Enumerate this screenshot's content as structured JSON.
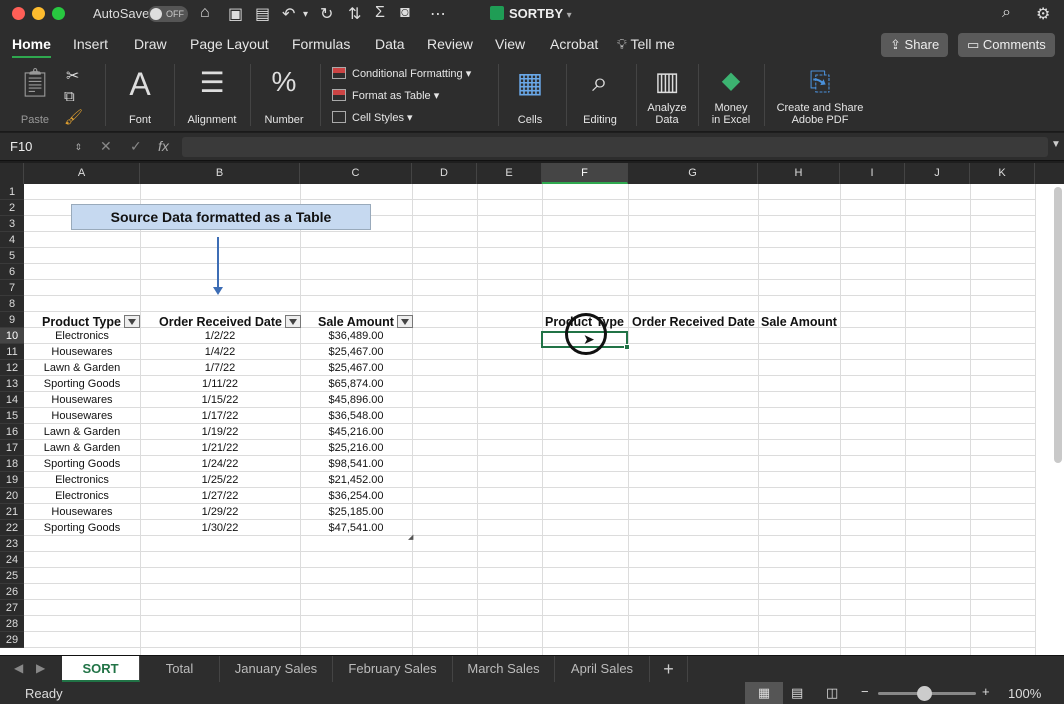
{
  "window": {
    "autosave_label": "AutoSave",
    "autosave_state": "OFF",
    "doc_title": "SORTBY"
  },
  "ribbon_tabs": [
    "Home",
    "Insert",
    "Draw",
    "Page Layout",
    "Formulas",
    "Data",
    "Review",
    "View",
    "Acrobat",
    "Tell me"
  ],
  "header_buttons": {
    "share": "Share",
    "comments": "Comments"
  },
  "ribbon": {
    "paste": "Paste",
    "font": "Font",
    "alignment": "Alignment",
    "number": "Number",
    "conditional_formatting": "Conditional Formatting",
    "format_as_table": "Format as Table",
    "cell_styles": "Cell Styles",
    "cells": "Cells",
    "editing": "Editing",
    "analyze_data_1": "Analyze",
    "analyze_data_2": "Data",
    "money_1": "Money",
    "money_2": "in Excel",
    "adobe_1": "Create and Share",
    "adobe_2": "Adobe PDF"
  },
  "formula_bar": {
    "name_box": "F10",
    "fx": "fx",
    "value": ""
  },
  "columns": [
    "A",
    "B",
    "C",
    "D",
    "E",
    "F",
    "G",
    "H",
    "I",
    "J",
    "K"
  ],
  "rows": [
    "1",
    "2",
    "3",
    "4",
    "5",
    "6",
    "7",
    "8",
    "9",
    "10",
    "11",
    "12",
    "13",
    "14",
    "15",
    "16",
    "17",
    "18",
    "19",
    "20",
    "21",
    "22",
    "23",
    "24",
    "25",
    "26",
    "27",
    "28",
    "29"
  ],
  "banner": "Source Data formatted as a Table",
  "table": {
    "headers": [
      "Product Type",
      "Order Received Date",
      "Sale Amount"
    ],
    "rows": [
      [
        "Electronics",
        "1/2/22",
        "$36,489.00"
      ],
      [
        "Housewares",
        "1/4/22",
        "$25,467.00"
      ],
      [
        "Lawn & Garden",
        "1/7/22",
        "$25,467.00"
      ],
      [
        "Sporting Goods",
        "1/11/22",
        "$65,874.00"
      ],
      [
        "Housewares",
        "1/15/22",
        "$45,896.00"
      ],
      [
        "Housewares",
        "1/17/22",
        "$36,548.00"
      ],
      [
        "Lawn & Garden",
        "1/19/22",
        "$45,216.00"
      ],
      [
        "Lawn & Garden",
        "1/21/22",
        "$25,216.00"
      ],
      [
        "Sporting Goods",
        "1/24/22",
        "$98,541.00"
      ],
      [
        "Electronics",
        "1/25/22",
        "$21,452.00"
      ],
      [
        "Electronics",
        "1/27/22",
        "$36,254.00"
      ],
      [
        "Housewares",
        "1/29/22",
        "$25,185.00"
      ],
      [
        "Sporting Goods",
        "1/30/22",
        "$47,541.00"
      ]
    ]
  },
  "output_headers": [
    "Product Type",
    "Order Received Date",
    "Sale Amount"
  ],
  "sheet_tabs": [
    "SORT",
    "Total",
    "January Sales",
    "February Sales",
    "March Sales",
    "April Sales"
  ],
  "add_sheet": "+",
  "status": {
    "ready": "Ready",
    "zoom": "100%",
    "zoom_minus": "−",
    "zoom_plus": "+"
  },
  "colors": {
    "accent": "#217346",
    "ribbon_bg": "#2d2d2d"
  }
}
